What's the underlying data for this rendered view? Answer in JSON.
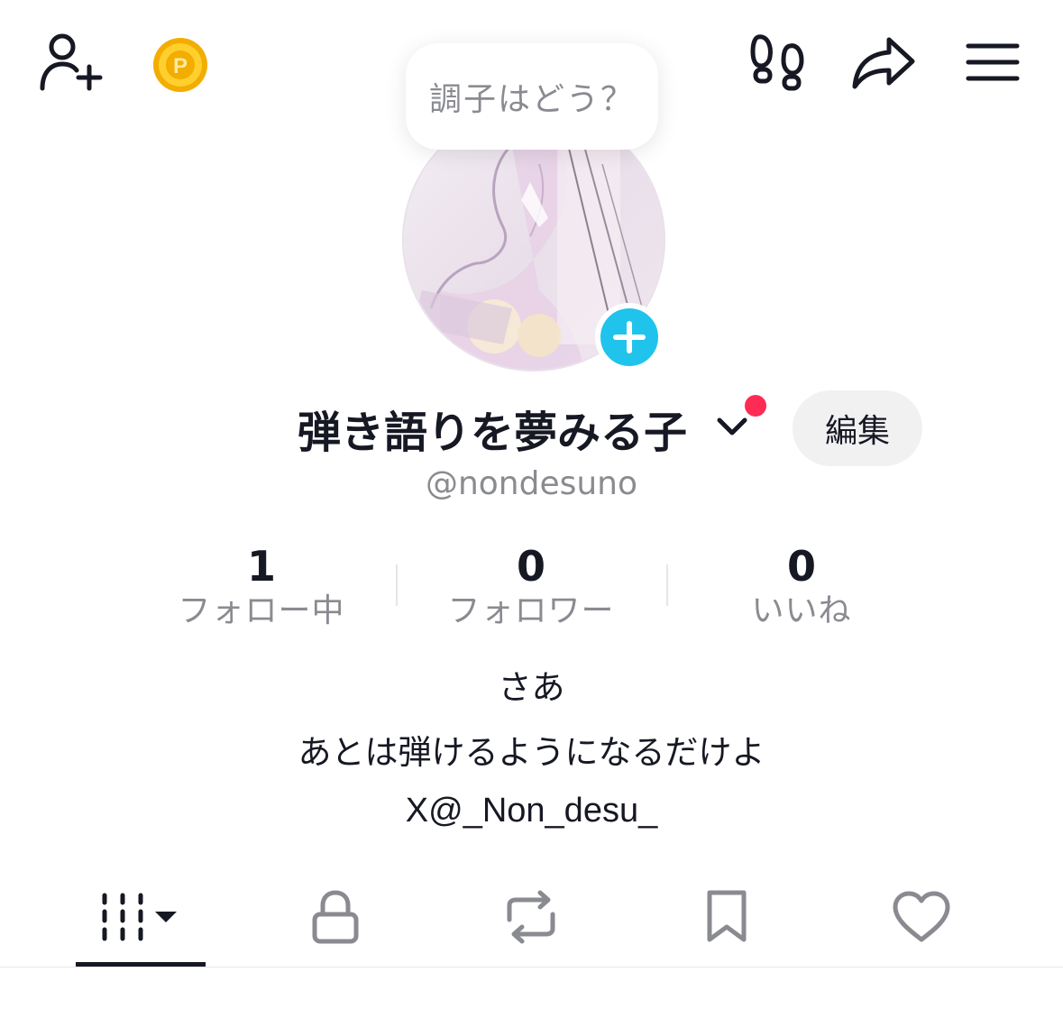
{
  "header": {
    "add_friend_icon": "person-add-icon",
    "coin_icon": "coin-icon",
    "coin_letter": "P",
    "footprints_icon": "footprints-icon",
    "share_icon": "share-icon",
    "menu_icon": "menu-icon"
  },
  "status_bubble": {
    "text": "調子はどう？"
  },
  "profile": {
    "display_name": "弾き語りを夢みる子",
    "handle": "@nondesuno",
    "edit_label": "編集",
    "avatar_add_icon": "plus-icon"
  },
  "stats": [
    {
      "value": "1",
      "label": "フォロー中"
    },
    {
      "value": "0",
      "label": "フォロワー"
    },
    {
      "value": "0",
      "label": "いいね"
    }
  ],
  "bio": {
    "lines": [
      "さあ",
      "あとは弾けるようになるだけよ",
      "X@_Non_desu_"
    ]
  },
  "tabs": [
    {
      "icon": "videos-grid-icon",
      "selected": true
    },
    {
      "icon": "lock-icon",
      "selected": false
    },
    {
      "icon": "repost-icon",
      "selected": false
    },
    {
      "icon": "bookmark-icon",
      "selected": false
    },
    {
      "icon": "heart-icon",
      "selected": false
    }
  ],
  "colors": {
    "accent_blue": "#20c3ec",
    "notification_red": "#fe2c55",
    "coin_gold": "#f5b800",
    "text_primary": "#161823",
    "text_secondary": "#8a8b91"
  }
}
